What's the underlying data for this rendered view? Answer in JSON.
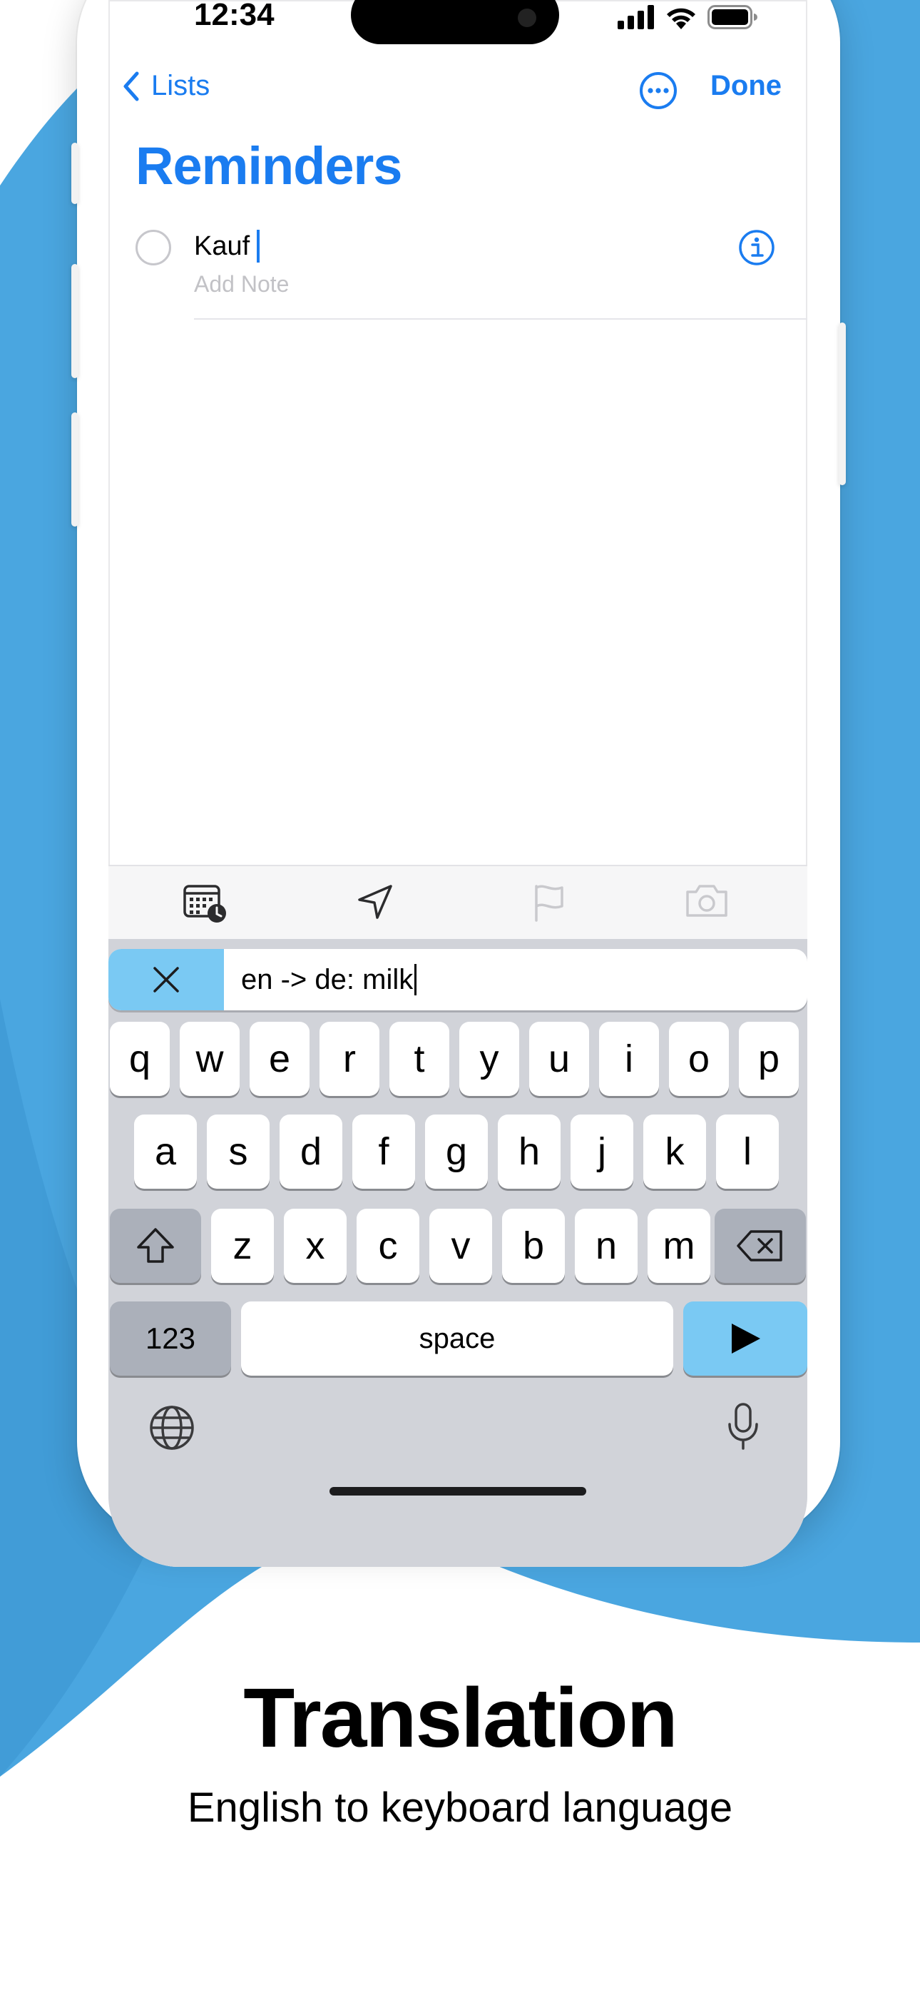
{
  "colors": {
    "accent": "#1a7cf0",
    "background_blob": "#4aa6e0",
    "keyboard_action": "#7ac9f3"
  },
  "status_bar": {
    "time": "12:34",
    "icons": [
      "cellular-signal-icon",
      "wifi-icon",
      "battery-icon"
    ]
  },
  "nav": {
    "back_label": "Lists",
    "more_icon": "ellipsis-circle-icon",
    "done_label": "Done"
  },
  "list": {
    "title": "Reminders"
  },
  "reminder": {
    "text": "Kauf",
    "note_placeholder": "Add Note",
    "info_icon": "info-circle-icon"
  },
  "toolbar": {
    "items": [
      "calendar-clock-icon",
      "location-arrow-icon",
      "flag-icon",
      "camera-icon"
    ]
  },
  "translate_bar": {
    "close_icon": "close-icon",
    "input_value": "en -> de: milk"
  },
  "keyboard": {
    "row1": [
      "q",
      "w",
      "e",
      "r",
      "t",
      "y",
      "u",
      "i",
      "o",
      "p"
    ],
    "row2": [
      "a",
      "s",
      "d",
      "f",
      "g",
      "h",
      "j",
      "k",
      "l"
    ],
    "row3": [
      "z",
      "x",
      "c",
      "v",
      "b",
      "n",
      "m"
    ],
    "numbers_label": "123",
    "space_label": "space",
    "icons": [
      "shift-icon",
      "backspace-icon",
      "send-icon",
      "globe-icon",
      "microphone-icon"
    ]
  },
  "caption": {
    "title": "Translation",
    "subtitle": "English to keyboard language"
  }
}
